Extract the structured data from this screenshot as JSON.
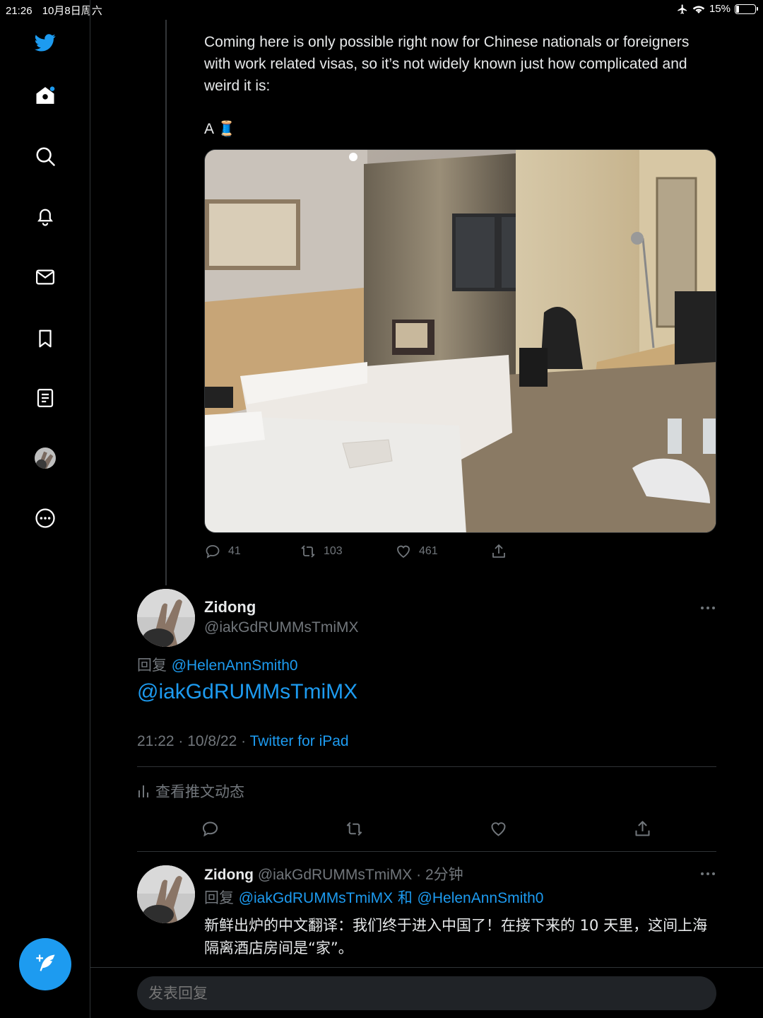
{
  "status_bar": {
    "time": "21:26",
    "date": "10月8日周六",
    "battery": "15%"
  },
  "sidebar": {
    "icons": [
      "twitter-logo-icon",
      "home-icon",
      "search-icon",
      "notifications-icon",
      "messages-icon",
      "bookmarks-icon",
      "lists-icon",
      "profile-avatar",
      "more-icon"
    ],
    "accent": "#1d9bf0"
  },
  "parent_tweet": {
    "text_line1": "Coming here is only possible right now for Chinese nationals or foreigners with work related visas, so it’s not widely known just how complicated and weird it is:",
    "text_line2": "A 🧵",
    "stats": {
      "replies": "41",
      "retweets": "103",
      "likes": "461"
    }
  },
  "focused_tweet": {
    "name": "Zidong",
    "handle": "@iakGdRUMMsTmiMX",
    "reply_prefix": "回复",
    "reply_to": "@HelenAnnSmith0",
    "body": "@iakGdRUMMsTmiMX",
    "timestamp": "21:22 · 10/8/22 · ",
    "source": "Twitter for iPad",
    "activity_label": "查看推文动态"
  },
  "reply_tweet": {
    "name": "Zidong",
    "handle_time": "@iakGdRUMMsTmiMX · 2分钟",
    "reply_prefix": "回复 ",
    "reply_to_1": "@iakGdRUMMsTmiMX",
    "reply_and": " 和 ",
    "reply_to_2": "@HelenAnnSmith0",
    "body": "新鲜出炉的中文翻译：我们终于进入中国了！在接下来的 10 天里，这间上海隔离酒店房间是“家”。"
  },
  "reply_box": {
    "placeholder": "发表回复"
  }
}
